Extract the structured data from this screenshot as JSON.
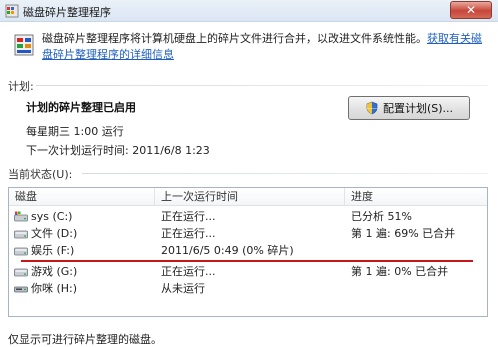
{
  "window": {
    "title": "磁盘碎片整理程序",
    "close_glyph": "✕"
  },
  "intro": {
    "text": "磁盘碎片整理程序将计算机硬盘上的碎片文件进行合并，以改进文件系统性能。",
    "link": "获取有关磁盘碎片整理程序的详细信息"
  },
  "schedule": {
    "section_label": "计划:",
    "status": "计划的碎片整理已启用",
    "frequency": "每星期三  1:00 运行",
    "next_run": "下一次计划运行时间: 2011/6/8 1:23",
    "configure_button": "配置计划(S)..."
  },
  "current_status": {
    "section_label": "当前状态(U):",
    "columns": [
      "磁盘",
      "上一次运行时间",
      "进度"
    ],
    "rows": [
      {
        "disk": "sys (C:)",
        "icon": "windows-drive-icon",
        "last_run": "正在运行...",
        "progress": "已分析 51%"
      },
      {
        "disk": "文件 (D:)",
        "icon": "drive-icon",
        "last_run": "正在运行...",
        "progress": "第 1 遍: 69% 已合并"
      },
      {
        "disk": "娱乐 (F:)",
        "icon": "drive-icon",
        "last_run": "2011/6/5 0:49 (0% 碎片)",
        "progress": ""
      },
      {
        "disk": "游戏 (G:)",
        "icon": "drive-icon",
        "last_run": "正在运行...",
        "progress": "第 1 遍: 0% 已合并"
      },
      {
        "disk": "你咪 (H:)",
        "icon": "removable-drive-icon",
        "last_run": "从未运行",
        "progress": ""
      }
    ],
    "annotation_color": "#c8161d"
  },
  "footer": {
    "note": "仅显示可进行碎片整理的磁盘。"
  }
}
